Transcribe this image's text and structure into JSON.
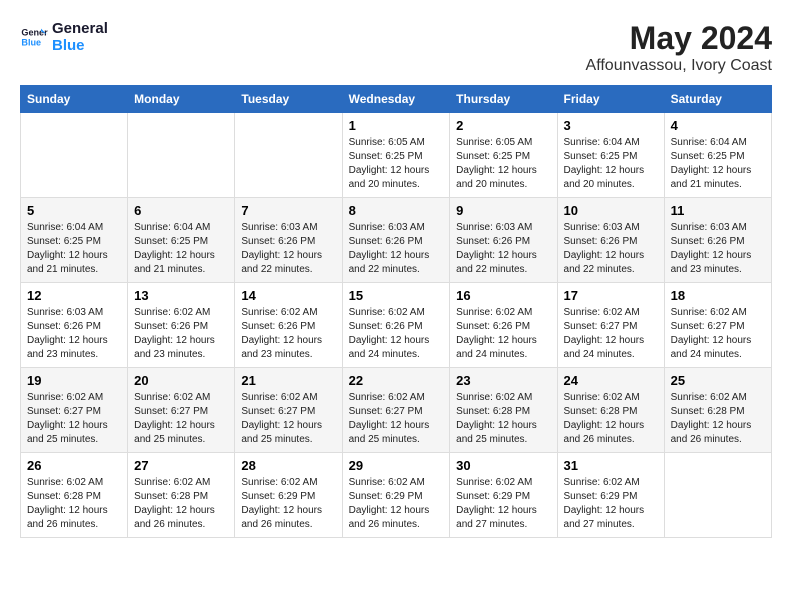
{
  "logo": {
    "line1": "General",
    "line2": "Blue"
  },
  "title": "May 2024",
  "location": "Affounvassou, Ivory Coast",
  "days_header": [
    "Sunday",
    "Monday",
    "Tuesday",
    "Wednesday",
    "Thursday",
    "Friday",
    "Saturday"
  ],
  "weeks": [
    [
      {
        "day": "",
        "sunrise": "",
        "sunset": "",
        "daylight": ""
      },
      {
        "day": "",
        "sunrise": "",
        "sunset": "",
        "daylight": ""
      },
      {
        "day": "",
        "sunrise": "",
        "sunset": "",
        "daylight": ""
      },
      {
        "day": "1",
        "sunrise": "Sunrise: 6:05 AM",
        "sunset": "Sunset: 6:25 PM",
        "daylight": "Daylight: 12 hours and 20 minutes."
      },
      {
        "day": "2",
        "sunrise": "Sunrise: 6:05 AM",
        "sunset": "Sunset: 6:25 PM",
        "daylight": "Daylight: 12 hours and 20 minutes."
      },
      {
        "day": "3",
        "sunrise": "Sunrise: 6:04 AM",
        "sunset": "Sunset: 6:25 PM",
        "daylight": "Daylight: 12 hours and 20 minutes."
      },
      {
        "day": "4",
        "sunrise": "Sunrise: 6:04 AM",
        "sunset": "Sunset: 6:25 PM",
        "daylight": "Daylight: 12 hours and 21 minutes."
      }
    ],
    [
      {
        "day": "5",
        "sunrise": "Sunrise: 6:04 AM",
        "sunset": "Sunset: 6:25 PM",
        "daylight": "Daylight: 12 hours and 21 minutes."
      },
      {
        "day": "6",
        "sunrise": "Sunrise: 6:04 AM",
        "sunset": "Sunset: 6:25 PM",
        "daylight": "Daylight: 12 hours and 21 minutes."
      },
      {
        "day": "7",
        "sunrise": "Sunrise: 6:03 AM",
        "sunset": "Sunset: 6:26 PM",
        "daylight": "Daylight: 12 hours and 22 minutes."
      },
      {
        "day": "8",
        "sunrise": "Sunrise: 6:03 AM",
        "sunset": "Sunset: 6:26 PM",
        "daylight": "Daylight: 12 hours and 22 minutes."
      },
      {
        "day": "9",
        "sunrise": "Sunrise: 6:03 AM",
        "sunset": "Sunset: 6:26 PM",
        "daylight": "Daylight: 12 hours and 22 minutes."
      },
      {
        "day": "10",
        "sunrise": "Sunrise: 6:03 AM",
        "sunset": "Sunset: 6:26 PM",
        "daylight": "Daylight: 12 hours and 22 minutes."
      },
      {
        "day": "11",
        "sunrise": "Sunrise: 6:03 AM",
        "sunset": "Sunset: 6:26 PM",
        "daylight": "Daylight: 12 hours and 23 minutes."
      }
    ],
    [
      {
        "day": "12",
        "sunrise": "Sunrise: 6:03 AM",
        "sunset": "Sunset: 6:26 PM",
        "daylight": "Daylight: 12 hours and 23 minutes."
      },
      {
        "day": "13",
        "sunrise": "Sunrise: 6:02 AM",
        "sunset": "Sunset: 6:26 PM",
        "daylight": "Daylight: 12 hours and 23 minutes."
      },
      {
        "day": "14",
        "sunrise": "Sunrise: 6:02 AM",
        "sunset": "Sunset: 6:26 PM",
        "daylight": "Daylight: 12 hours and 23 minutes."
      },
      {
        "day": "15",
        "sunrise": "Sunrise: 6:02 AM",
        "sunset": "Sunset: 6:26 PM",
        "daylight": "Daylight: 12 hours and 24 minutes."
      },
      {
        "day": "16",
        "sunrise": "Sunrise: 6:02 AM",
        "sunset": "Sunset: 6:26 PM",
        "daylight": "Daylight: 12 hours and 24 minutes."
      },
      {
        "day": "17",
        "sunrise": "Sunrise: 6:02 AM",
        "sunset": "Sunset: 6:27 PM",
        "daylight": "Daylight: 12 hours and 24 minutes."
      },
      {
        "day": "18",
        "sunrise": "Sunrise: 6:02 AM",
        "sunset": "Sunset: 6:27 PM",
        "daylight": "Daylight: 12 hours and 24 minutes."
      }
    ],
    [
      {
        "day": "19",
        "sunrise": "Sunrise: 6:02 AM",
        "sunset": "Sunset: 6:27 PM",
        "daylight": "Daylight: 12 hours and 25 minutes."
      },
      {
        "day": "20",
        "sunrise": "Sunrise: 6:02 AM",
        "sunset": "Sunset: 6:27 PM",
        "daylight": "Daylight: 12 hours and 25 minutes."
      },
      {
        "day": "21",
        "sunrise": "Sunrise: 6:02 AM",
        "sunset": "Sunset: 6:27 PM",
        "daylight": "Daylight: 12 hours and 25 minutes."
      },
      {
        "day": "22",
        "sunrise": "Sunrise: 6:02 AM",
        "sunset": "Sunset: 6:27 PM",
        "daylight": "Daylight: 12 hours and 25 minutes."
      },
      {
        "day": "23",
        "sunrise": "Sunrise: 6:02 AM",
        "sunset": "Sunset: 6:28 PM",
        "daylight": "Daylight: 12 hours and 25 minutes."
      },
      {
        "day": "24",
        "sunrise": "Sunrise: 6:02 AM",
        "sunset": "Sunset: 6:28 PM",
        "daylight": "Daylight: 12 hours and 26 minutes."
      },
      {
        "day": "25",
        "sunrise": "Sunrise: 6:02 AM",
        "sunset": "Sunset: 6:28 PM",
        "daylight": "Daylight: 12 hours and 26 minutes."
      }
    ],
    [
      {
        "day": "26",
        "sunrise": "Sunrise: 6:02 AM",
        "sunset": "Sunset: 6:28 PM",
        "daylight": "Daylight: 12 hours and 26 minutes."
      },
      {
        "day": "27",
        "sunrise": "Sunrise: 6:02 AM",
        "sunset": "Sunset: 6:28 PM",
        "daylight": "Daylight: 12 hours and 26 minutes."
      },
      {
        "day": "28",
        "sunrise": "Sunrise: 6:02 AM",
        "sunset": "Sunset: 6:29 PM",
        "daylight": "Daylight: 12 hours and 26 minutes."
      },
      {
        "day": "29",
        "sunrise": "Sunrise: 6:02 AM",
        "sunset": "Sunset: 6:29 PM",
        "daylight": "Daylight: 12 hours and 26 minutes."
      },
      {
        "day": "30",
        "sunrise": "Sunrise: 6:02 AM",
        "sunset": "Sunset: 6:29 PM",
        "daylight": "Daylight: 12 hours and 27 minutes."
      },
      {
        "day": "31",
        "sunrise": "Sunrise: 6:02 AM",
        "sunset": "Sunset: 6:29 PM",
        "daylight": "Daylight: 12 hours and 27 minutes."
      },
      {
        "day": "",
        "sunrise": "",
        "sunset": "",
        "daylight": ""
      }
    ]
  ]
}
